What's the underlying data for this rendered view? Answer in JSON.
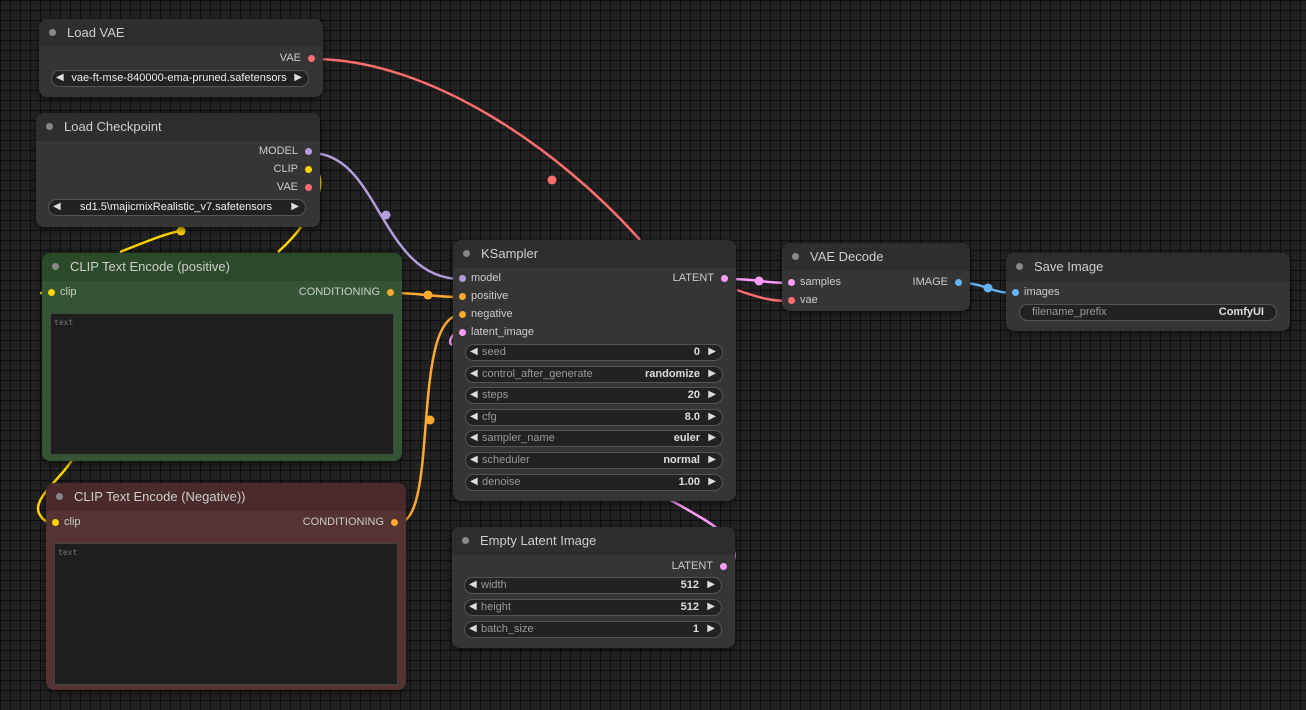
{
  "colors": {
    "vae": "#ff6e6e",
    "model": "#b39ddb",
    "clip": "#ffd500",
    "conditioning": "#ffa931",
    "latent": "#ff9cf9",
    "image": "#64b5f6"
  },
  "nodes": {
    "load_vae": {
      "title": "Load VAE",
      "output_vae": "VAE",
      "vae_name": "vae-ft-mse-840000-ema-pruned.safetensors"
    },
    "load_checkpoint": {
      "title": "Load Checkpoint",
      "output_model": "MODEL",
      "output_clip": "CLIP",
      "output_vae": "VAE",
      "ckpt_name": "sd1.5\\majicmixRealistic_v7.safetensors"
    },
    "clip_positive": {
      "title": "CLIP Text Encode (positive)",
      "input_clip": "clip",
      "output": "CONDITIONING",
      "text_placeholder": "text"
    },
    "clip_negative": {
      "title": "CLIP Text Encode (Negative))",
      "input_clip": "clip",
      "output": "CONDITIONING",
      "text_placeholder": "text"
    },
    "ksampler": {
      "title": "KSampler",
      "inputs": [
        "model",
        "positive",
        "negative",
        "latent_image"
      ],
      "output": "LATENT",
      "widgets": [
        {
          "label": "seed",
          "value": "0"
        },
        {
          "label": "control_after_generate",
          "value": "randomize"
        },
        {
          "label": "steps",
          "value": "20"
        },
        {
          "label": "cfg",
          "value": "8.0"
        },
        {
          "label": "sampler_name",
          "value": "euler"
        },
        {
          "label": "scheduler",
          "value": "normal"
        },
        {
          "label": "denoise",
          "value": "1.00"
        }
      ]
    },
    "empty_latent": {
      "title": "Empty Latent Image",
      "output": "LATENT",
      "widgets": [
        {
          "label": "width",
          "value": "512"
        },
        {
          "label": "height",
          "value": "512"
        },
        {
          "label": "batch_size",
          "value": "1"
        }
      ]
    },
    "vae_decode": {
      "title": "VAE Decode",
      "input_samples": "samples",
      "input_vae": "vae",
      "output": "IMAGE"
    },
    "save_image": {
      "title": "Save Image",
      "input_images": "images",
      "filename_prefix_label": "filename_prefix",
      "filename_prefix_value": "ComfyUI"
    }
  },
  "icons": {
    "arrow_left": "◀",
    "arrow_right": "▶"
  }
}
